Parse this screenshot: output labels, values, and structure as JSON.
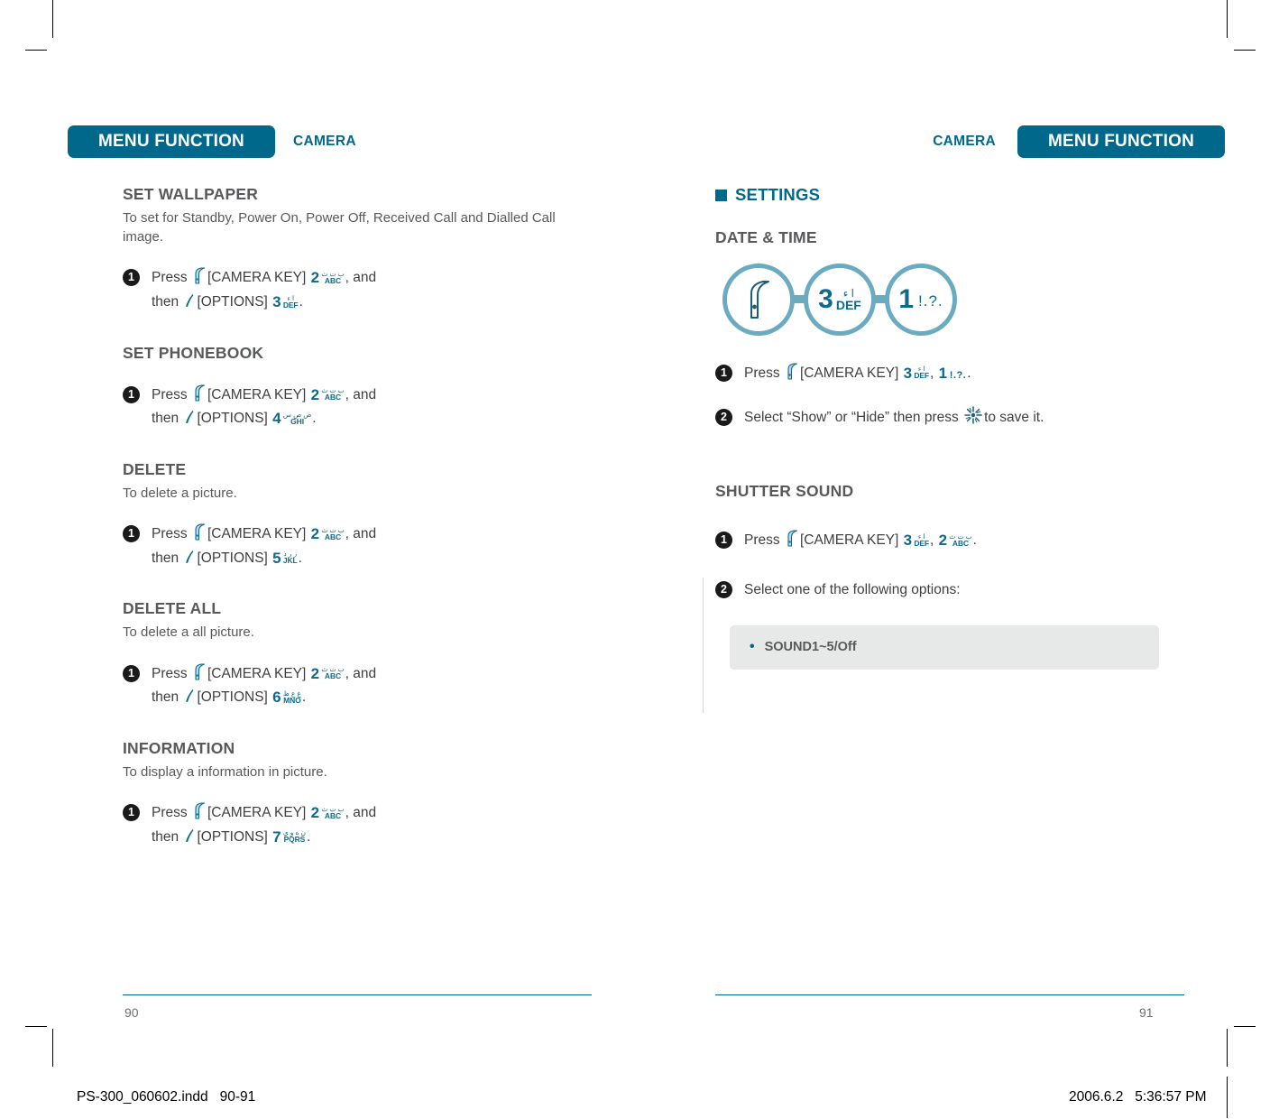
{
  "header": {
    "left": {
      "pill": "MENU FUNCTION",
      "sub": "CAMERA"
    },
    "right": {
      "pill": "MENU FUNCTION",
      "sub": "CAMERA"
    }
  },
  "left_page": {
    "page_number": "90",
    "sections": [
      {
        "title": "SET WALLPAPER",
        "description": "To set for Standby, Power On, Power Off, Received Call and Dialled Call image.",
        "steps": [
          {
            "badge": "1",
            "line1_pre": "Press",
            "line1_icon": "camera-key-icon",
            "line1_mid": "[CAMERA KEY]",
            "line1_key": {
              "digit": "2",
              "arabic": "ﺏ ﺕ ﺙ",
              "latin": "ABC"
            },
            "line1_post": ", and",
            "line2_pre": "then",
            "line2_icon": "options-key-icon",
            "line2_mid": "[OPTIONS]",
            "line2_key": {
              "digit": "3",
              "arabic": "ﺍ ﺀ",
              "latin": "DEF"
            },
            "line2_post": "."
          }
        ]
      },
      {
        "title": "SET PHONEBOOK",
        "description": "",
        "steps": [
          {
            "badge": "1",
            "line1_pre": "Press",
            "line1_icon": "camera-key-icon",
            "line1_mid": "[CAMERA KEY]",
            "line1_key": {
              "digit": "2",
              "arabic": "ﺏ ﺕ ﺙ",
              "latin": "ABC"
            },
            "line1_post": ", and",
            "line2_pre": "then",
            "line2_icon": "options-key-icon",
            "line2_mid": "[OPTIONS]",
            "line2_key": {
              "digit": "4",
              "arabic": "ﺽ ﺹ ﺱ",
              "latin": "GHI"
            },
            "line2_post": "."
          }
        ]
      },
      {
        "title": "DELETE",
        "description": "To delete a picture.",
        "steps": [
          {
            "badge": "1",
            "line1_pre": "Press",
            "line1_icon": "camera-key-icon",
            "line1_mid": "[CAMERA KEY]",
            "line1_key": {
              "digit": "2",
              "arabic": "ﺏ ﺕ ﺙ",
              "latin": "ABC"
            },
            "line1_post": ", and",
            "line2_pre": "then",
            "line2_icon": "options-key-icon",
            "line2_mid": "[OPTIONS]",
            "line2_key": {
              "digit": "5",
              "arabic": "ﺯ ﺭ ﺫ",
              "latin": "JKL"
            },
            "line2_post": "."
          }
        ]
      },
      {
        "title": "DELETE ALL",
        "description": "To delete a all picture.",
        "steps": [
          {
            "badge": "1",
            "line1_pre": "Press",
            "line1_icon": "camera-key-icon",
            "line1_mid": "[CAMERA KEY]",
            "line1_key": {
              "digit": "2",
              "arabic": "ﺏ ﺕ ﺙ",
              "latin": "ABC"
            },
            "line1_post": ", and",
            "line2_pre": "then",
            "line2_icon": "options-key-icon",
            "line2_mid": "[OPTIONS]",
            "line2_key": {
              "digit": "6",
              "arabic": "ﻍ ﻉ ﻅ",
              "latin": "MNO"
            },
            "line2_post": "."
          }
        ]
      },
      {
        "title": "INFORMATION",
        "description": "To display a information in picture.",
        "steps": [
          {
            "badge": "1",
            "line1_pre": "Press",
            "line1_icon": "camera-key-icon",
            "line1_mid": "[CAMERA KEY]",
            "line1_key": {
              "digit": "2",
              "arabic": "ﺏ ﺕ ﺙ",
              "latin": "ABC"
            },
            "line1_post": ", and",
            "line2_pre": "then",
            "line2_icon": "options-key-icon",
            "line2_mid": "[OPTIONS]",
            "line2_key": {
              "digit": "7",
              "arabic": "ﻥ ﻩ ﻭ ﻱ",
              "latin": "PQRS"
            },
            "line2_post": "."
          }
        ]
      }
    ]
  },
  "right_page": {
    "page_number": "91",
    "settings_heading": "SETTINGS",
    "date_time": {
      "title": "DATE & TIME",
      "flow": [
        {
          "type": "icon",
          "icon": "camera-key-icon"
        },
        {
          "type": "key",
          "digit": "3",
          "arabic": "ﺍ ﺀ",
          "latin": "DEF"
        },
        {
          "type": "key",
          "digit": "1",
          "punct": "!.?."
        }
      ],
      "steps": [
        {
          "badge": "1",
          "pre": "Press",
          "icon": "camera-key-icon",
          "mid": "[CAMERA KEY]",
          "key1": {
            "digit": "3",
            "arabic": "ﺍ ﺀ",
            "latin": "DEF"
          },
          "sep": ",",
          "key2": {
            "digit": "1",
            "punct": "!.?."
          },
          "post": "."
        },
        {
          "badge": "2",
          "text_before": "Select “Show” or “Hide” then press",
          "icon": "ok-starburst-icon",
          "text_after": "to save it."
        }
      ]
    },
    "shutter_sound": {
      "title": "SHUTTER SOUND",
      "steps": [
        {
          "badge": "1",
          "pre": "Press",
          "icon": "camera-key-icon",
          "mid": "[CAMERA KEY]",
          "key1": {
            "digit": "3",
            "arabic": "ﺍ ﺀ",
            "latin": "DEF"
          },
          "sep": ",",
          "key2": {
            "digit": "2",
            "arabic": "ﺏ ﺕ ﺙ",
            "latin": "ABC"
          },
          "post": "."
        },
        {
          "badge": "2",
          "text_before": "Select one of the following options:"
        }
      ],
      "options": [
        {
          "bullet": "•",
          "label": "SOUND1~5/Off"
        }
      ]
    }
  },
  "print_slug": {
    "left": "PS-300_060602.indd   90-91",
    "right": "2006.6.2   5:36:57 PM"
  },
  "colors": {
    "teal": "#00688b",
    "light_teal": "#6aabc0",
    "key_blue": "#0e6a8c",
    "gray_text": "#58595b",
    "option_bg": "#e7e8e8"
  }
}
